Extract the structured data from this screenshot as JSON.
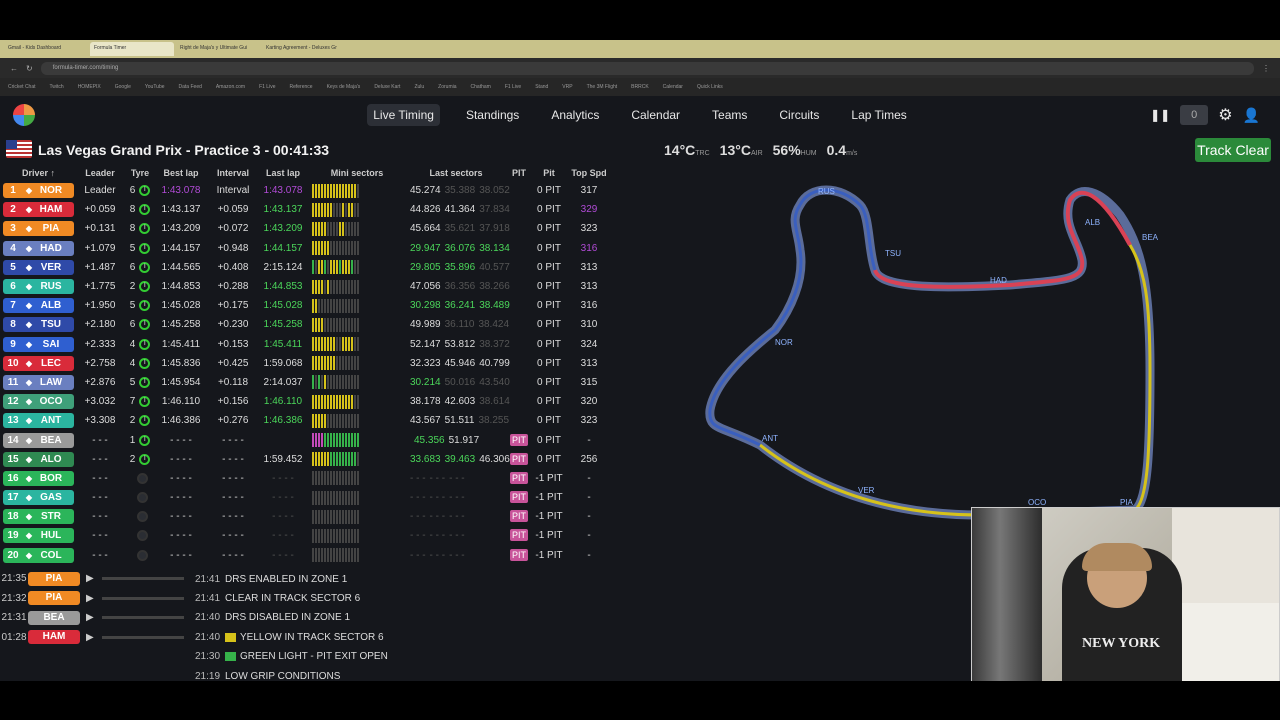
{
  "browser": {
    "tabs": [
      "Gmail - Kids Dashboard",
      "Formula Timer",
      "Right de Maja's y Ultimate Gui",
      "Karting Agreement - Deluxes Gr"
    ],
    "url": "formula-timer.com/timing",
    "bookmarks": [
      "Cricket Chat",
      "Twitch",
      "HOMEPIX",
      "Google",
      "YouTube",
      "Data Feed",
      "Amazon.com",
      "F1 Live",
      "Reference",
      "Keys de Maja's",
      "Deluxe Kart",
      "Zulu",
      "Zorumia",
      "Chatham",
      "F1 Live",
      "Stand",
      "VRP",
      "The 3M Flight",
      "BRRCK",
      "Calendar",
      "Quick Links"
    ]
  },
  "nav": {
    "items": [
      "Live Timing",
      "Standings",
      "Analytics",
      "Calendar",
      "Teams",
      "Circuits",
      "Lap Times"
    ],
    "active": "Live Timing",
    "counter": "0"
  },
  "session": {
    "title": "Las Vegas Grand Prix - Practice 3 - 00:41:33",
    "weather": [
      {
        "v": "14°C",
        "u": "TRC"
      },
      {
        "v": "13°C",
        "u": "AIR"
      },
      {
        "v": "56%",
        "u": "HUM"
      },
      {
        "v": "0.4",
        "u": "m/s"
      }
    ],
    "track_status": "Track Clear",
    "track_color": "#2b8a3a"
  },
  "columns": [
    "Driver ↑",
    "Leader",
    "Tyre",
    "Best lap",
    "Interval",
    "Last lap",
    "Mini sectors",
    "Last sectors",
    "PIT",
    "Pit",
    "Top Spd"
  ],
  "drivers": [
    {
      "pos": "1",
      "code": "NOR",
      "team": "#f08a24",
      "leader": "Leader",
      "laps": "6",
      "tyre": "I",
      "best": "1:43.078",
      "best_cls": "pu",
      "int": "Interval",
      "last": "1:43.078",
      "last_cls": "pu",
      "mini": "yyyyyyyyyyyyyyy.",
      "s": [
        "45.274",
        "35.388",
        "38.052"
      ],
      "sc": [
        "",
        "dim",
        "dim"
      ],
      "pit": "",
      "pits": "0 PIT",
      "spd": "317"
    },
    {
      "pos": "2",
      "code": "HAM",
      "team": "#d92b3a",
      "leader": "+0.059",
      "laps": "8",
      "tyre": "I",
      "best": "1:43.137",
      "int": "+0.059",
      "last": "1:43.137",
      "last_cls": "gn",
      "mini": "yyyyyyy...y.yy..",
      "s": [
        "44.826",
        "41.364",
        "37.834"
      ],
      "sc": [
        "",
        "",
        "dim"
      ],
      "pit": "",
      "pits": "0 PIT",
      "spd": "329",
      "spd_cls": "pu"
    },
    {
      "pos": "3",
      "code": "PIA",
      "team": "#f08a24",
      "leader": "+0.131",
      "laps": "8",
      "tyre": "I",
      "best": "1:43.209",
      "int": "+0.072",
      "last": "1:43.209",
      "last_cls": "gn",
      "mini": "yyyyy....yy.....",
      "s": [
        "45.664",
        "35.621",
        "37.918"
      ],
      "sc": [
        "",
        "dim",
        "dim"
      ],
      "pit": "",
      "pits": "0 PIT",
      "spd": "323"
    },
    {
      "pos": "4",
      "code": "HAD",
      "team": "#6a7fc0",
      "leader": "+1.079",
      "laps": "5",
      "tyre": "I",
      "best": "1:44.157",
      "int": "+0.948",
      "last": "1:44.157",
      "last_cls": "gn",
      "mini": "yyyyyy..........",
      "s": [
        "29.947",
        "36.076",
        "38.134"
      ],
      "sc": [
        "gn",
        "gn",
        "gn"
      ],
      "pit": "",
      "pits": "0 PIT",
      "spd": "316",
      "spd_cls": "pu"
    },
    {
      "pos": "5",
      "code": "VER",
      "team": "#2f4aa8",
      "leader": "+1.487",
      "laps": "6",
      "tyre": "I",
      "best": "1:44.565",
      "int": "+0.408",
      "last": "2:15.124",
      "last_cls": "",
      "mini": "g.yyg.yyygyyyg..",
      "s": [
        "29.805",
        "35.896",
        "40.577"
      ],
      "sc": [
        "gn",
        "gn",
        "dim"
      ],
      "pit": "",
      "pits": "0 PIT",
      "spd": "313"
    },
    {
      "pos": "6",
      "code": "RUS",
      "team": "#2bb5a0",
      "leader": "+1.775",
      "laps": "2",
      "tyre": "I",
      "best": "1:44.853",
      "int": "+0.288",
      "last": "1:44.853",
      "last_cls": "gn",
      "mini": "yyyy.y..........",
      "s": [
        "47.056",
        "36.356",
        "38.266"
      ],
      "sc": [
        "",
        "dim",
        "dim"
      ],
      "pit": "",
      "pits": "0 PIT",
      "spd": "313"
    },
    {
      "pos": "7",
      "code": "ALB",
      "team": "#2f5fd0",
      "leader": "+1.950",
      "laps": "5",
      "tyre": "I",
      "best": "1:45.028",
      "int": "+0.175",
      "last": "1:45.028",
      "last_cls": "gn",
      "mini": "yy..............",
      "s": [
        "30.298",
        "36.241",
        "38.489"
      ],
      "sc": [
        "gn",
        "gn",
        "gn"
      ],
      "pit": "",
      "pits": "0 PIT",
      "spd": "316"
    },
    {
      "pos": "8",
      "code": "TSU",
      "team": "#2f4aa8",
      "leader": "+2.180",
      "laps": "6",
      "tyre": "I",
      "best": "1:45.258",
      "int": "+0.230",
      "last": "1:45.258",
      "last_cls": "gn",
      "mini": "yyyy............",
      "s": [
        "49.989",
        "36.110",
        "38.424"
      ],
      "sc": [
        "",
        "dim",
        "dim"
      ],
      "pit": "",
      "pits": "0 PIT",
      "spd": "310"
    },
    {
      "pos": "9",
      "code": "SAI",
      "team": "#2f5fd0",
      "leader": "+2.333",
      "laps": "4",
      "tyre": "I",
      "best": "1:45.411",
      "int": "+0.153",
      "last": "1:45.411",
      "last_cls": "gn",
      "mini": "yyyyyyyy..yyyy..",
      "s": [
        "52.147",
        "53.812",
        "38.372"
      ],
      "sc": [
        "",
        "",
        "dim"
      ],
      "pit": "",
      "pits": "0 PIT",
      "spd": "324"
    },
    {
      "pos": "10",
      "code": "LEC",
      "team": "#d92b3a",
      "leader": "+2.758",
      "laps": "4",
      "tyre": "I",
      "best": "1:45.836",
      "int": "+0.425",
      "last": "1:59.068",
      "last_cls": "",
      "mini": "yyyyyyyy........",
      "s": [
        "32.323",
        "45.946",
        "40.799"
      ],
      "sc": [
        "",
        "",
        ""
      ],
      "pit": "",
      "pits": "0 PIT",
      "spd": "313"
    },
    {
      "pos": "11",
      "code": "LAW",
      "team": "#6a7fc0",
      "leader": "+2.876",
      "laps": "5",
      "tyre": "I",
      "best": "1:45.954",
      "int": "+0.118",
      "last": "2:14.037",
      "last_cls": "",
      "mini": "g.g.y...........",
      "s": [
        "30.214",
        "50.016",
        "43.540"
      ],
      "sc": [
        "gn",
        "dim",
        "dim"
      ],
      "pit": "",
      "pits": "0 PIT",
      "spd": "315"
    },
    {
      "pos": "12",
      "code": "OCO",
      "team": "#3fa07a",
      "leader": "+3.032",
      "laps": "7",
      "tyre": "I",
      "best": "1:46.110",
      "int": "+0.156",
      "last": "1:46.110",
      "last_cls": "gn",
      "mini": "yyyyyyyyyyyyyy..",
      "s": [
        "38.178",
        "42.603",
        "38.614"
      ],
      "sc": [
        "",
        "",
        "dim"
      ],
      "pit": "",
      "pits": "0 PIT",
      "spd": "320"
    },
    {
      "pos": "13",
      "code": "ANT",
      "team": "#2bb5a0",
      "leader": "+3.308",
      "laps": "2",
      "tyre": "I",
      "best": "1:46.386",
      "int": "+0.276",
      "last": "1:46.386",
      "last_cls": "gn",
      "mini": "yyyyy...........",
      "s": [
        "43.567",
        "51.511",
        "38.255"
      ],
      "sc": [
        "",
        "",
        "dim"
      ],
      "pit": "",
      "pits": "0 PIT",
      "spd": "323"
    },
    {
      "pos": "14",
      "code": "BEA",
      "team": "#9a9a9a",
      "leader": "- - -",
      "laps": "1",
      "tyre": "I",
      "best": "- - - -",
      "int": "- - - -",
      "last": "",
      "last_cls": "",
      "mini": "ppppgggggggggggg",
      "s": [
        "",
        "45.356",
        "51.917"
      ],
      "sc": [
        "",
        "gn",
        ""
      ],
      "pit": "PIT",
      "pits": "0 PIT",
      "spd": "-"
    },
    {
      "pos": "15",
      "code": "ALO",
      "team": "#2f8a52",
      "leader": "- - -",
      "laps": "2",
      "tyre": "I",
      "best": "- - - -",
      "int": "- - - -",
      "last": "1:59.452",
      "last_cls": "",
      "mini": "yyyyyyggggggggg.",
      "s": [
        "33.683",
        "39.463",
        "46.306"
      ],
      "sc": [
        "gn",
        "gn",
        ""
      ],
      "pit": "PIT",
      "pits": "0 PIT",
      "spd": "256"
    },
    {
      "pos": "16",
      "code": "BOR",
      "team": "#2bb55a",
      "leader": "- - -",
      "laps": "",
      "tyre": "",
      "best": "- - - -",
      "int": "- - - -",
      "last": "- - - -",
      "last_cls": "dim",
      "mini": "................",
      "s": [
        "- - -",
        "- - -",
        "- - -"
      ],
      "sc": [
        "dim",
        "dim",
        "dim"
      ],
      "pit": "PIT",
      "pits": "-1 PIT",
      "spd": "-"
    },
    {
      "pos": "17",
      "code": "GAS",
      "team": "#2bb5a0",
      "leader": "- - -",
      "laps": "",
      "tyre": "",
      "best": "- - - -",
      "int": "- - - -",
      "last": "- - - -",
      "last_cls": "dim",
      "mini": "................",
      "s": [
        "- - -",
        "- - -",
        "- - -"
      ],
      "sc": [
        "dim",
        "dim",
        "dim"
      ],
      "pit": "PIT",
      "pits": "-1 PIT",
      "spd": "-"
    },
    {
      "pos": "18",
      "code": "STR",
      "team": "#2bb55a",
      "leader": "- - -",
      "laps": "",
      "tyre": "",
      "best": "- - - -",
      "int": "- - - -",
      "last": "- - - -",
      "last_cls": "dim",
      "mini": "................",
      "s": [
        "- - -",
        "- - -",
        "- - -"
      ],
      "sc": [
        "dim",
        "dim",
        "dim"
      ],
      "pit": "PIT",
      "pits": "-1 PIT",
      "spd": "-"
    },
    {
      "pos": "19",
      "code": "HUL",
      "team": "#2bb55a",
      "leader": "- - -",
      "laps": "",
      "tyre": "",
      "best": "- - - -",
      "int": "- - - -",
      "last": "- - - -",
      "last_cls": "dim",
      "mini": "................",
      "s": [
        "- - -",
        "- - -",
        "- - -"
      ],
      "sc": [
        "dim",
        "dim",
        "dim"
      ],
      "pit": "PIT",
      "pits": "-1 PIT",
      "spd": "-"
    },
    {
      "pos": "20",
      "code": "COL",
      "team": "#2bb55a",
      "leader": "- - -",
      "laps": "",
      "tyre": "",
      "best": "- - - -",
      "int": "- - - -",
      "last": "- - - -",
      "last_cls": "dim",
      "mini": "................",
      "s": [
        "- - -",
        "- - -",
        "- - -"
      ],
      "sc": [
        "dim",
        "dim",
        "dim"
      ],
      "pit": "PIT",
      "pits": "-1 PIT",
      "spd": "-"
    }
  ],
  "radio": [
    {
      "t": "21:35",
      "d": "PIA",
      "c": "#f08a24"
    },
    {
      "t": "21:32",
      "d": "PIA",
      "c": "#f08a24"
    },
    {
      "t": "21:31",
      "d": "BEA",
      "c": "#9a9a9a"
    },
    {
      "t": "01:28",
      "d": "HAM",
      "c": "#d92b3a"
    }
  ],
  "messages": [
    {
      "t": "21:41",
      "m": "DRS ENABLED IN ZONE 1",
      "c": ""
    },
    {
      "t": "21:41",
      "m": "CLEAR IN TRACK SECTOR 6",
      "c": ""
    },
    {
      "t": "21:40",
      "m": "DRS DISABLED IN ZONE 1",
      "c": ""
    },
    {
      "t": "21:40",
      "m": "YELLOW IN TRACK SECTOR 6",
      "c": "#d6c21a"
    },
    {
      "t": "21:30",
      "m": "GREEN LIGHT - PIT EXIT OPEN",
      "c": "#36b24a"
    },
    {
      "t": "21:19",
      "m": "LOW GRIP CONDITIONS",
      "c": ""
    }
  ],
  "map_labels": [
    "RUS",
    "TSU",
    "HAD",
    "ALB",
    "BEA",
    "NOR",
    "ANT",
    "VER",
    "OCO",
    "PIA"
  ],
  "webcam": {
    "shirt_text": "NEW YORK"
  }
}
